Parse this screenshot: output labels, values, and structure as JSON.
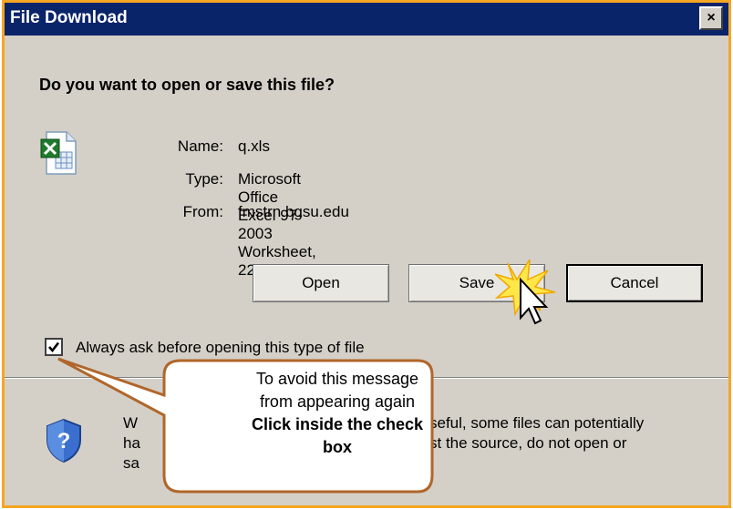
{
  "window": {
    "title": "File Download",
    "close_label": "×"
  },
  "question": "Do you want to open or save this file?",
  "file": {
    "icon": "excel-file-icon",
    "name_label": "Name:",
    "name_value": "q.xls",
    "type_label": "Type:",
    "type_value": "Microsoft Office Excel 97-2003 Worksheet, 22.0KB",
    "from_label": "From:",
    "from_value": "fmstrn.bgsu.edu"
  },
  "buttons": {
    "open": "Open",
    "save": "Save",
    "cancel": "Cancel"
  },
  "checkbox": {
    "checked": true,
    "label": "Always ask before opening this type of file"
  },
  "warning": {
    "icon": "shield-question-icon",
    "line1": "W",
    "line1_end": "seful, some files can potentially",
    "line2": "ha",
    "line2_end": "st the source, do not open or",
    "line3": "sa"
  },
  "callout": {
    "line1": "To avoid this message",
    "line2": "from appearing again",
    "line3": "Click inside the check",
    "line4": "box"
  },
  "colors": {
    "title_bar": "#0a246a",
    "dialog_bg": "#d4d0c8",
    "border_accent": "#f5a623",
    "callout_border": "#b0662a"
  }
}
